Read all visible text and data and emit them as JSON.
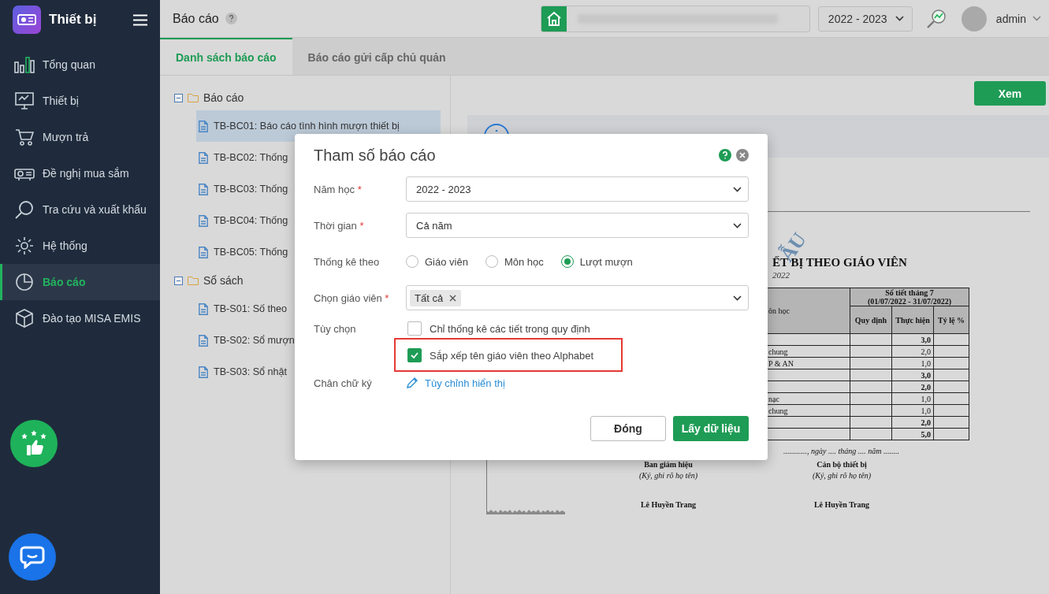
{
  "sidebar": {
    "app_title": "Thiết bị",
    "items": [
      {
        "label": "Tổng quan",
        "selected": false
      },
      {
        "label": "Thiết bị",
        "selected": false
      },
      {
        "label": "Mượn trả",
        "selected": false
      },
      {
        "label": "Đề nghị mua sắm",
        "selected": false
      },
      {
        "label": "Tra cứu và xuất khẩu",
        "selected": false
      },
      {
        "label": "Hệ thống",
        "selected": false
      },
      {
        "label": "Báo cáo",
        "selected": true
      },
      {
        "label": "Đào tạo MISA EMIS",
        "selected": false
      }
    ]
  },
  "header": {
    "title": "Báo cáo",
    "school_year": "2022 - 2023",
    "user": "admin"
  },
  "tabs": [
    {
      "label": "Danh sách báo cáo",
      "selected": true
    },
    {
      "label": "Báo cáo gửi cấp chủ quản",
      "selected": false
    }
  ],
  "tree": [
    {
      "label": "Báo cáo",
      "expanded": true,
      "children": [
        {
          "label": "TB-BC01: Báo cáo tình hình mượn thiết bị",
          "selected": true
        },
        {
          "label": "TB-BC02: Thống",
          "selected": false
        },
        {
          "label": "TB-BC03: Thống",
          "selected": false
        },
        {
          "label": "TB-BC04: Thống",
          "selected": false
        },
        {
          "label": "TB-BC05: Thống",
          "selected": false
        }
      ]
    },
    {
      "label": "Sổ sách",
      "expanded": true,
      "children": [
        {
          "label": "TB-S01: Số theo",
          "selected": false
        },
        {
          "label": "TB-S02: Sổ mượn",
          "selected": false
        },
        {
          "label": "TB-S03: Sổ nhật",
          "selected": false
        }
      ]
    }
  ],
  "preview": {
    "view_button": "Xem",
    "document": {
      "stamp": "ẪU",
      "title": "ẾT BỊ THEO GIÁO VIÊN",
      "subtitle": "2022",
      "columns": {
        "column_1": "ôn học",
        "group_title": "Số tiết tháng 7",
        "group_period": "(01/07/2022 - 31/07/2022)",
        "planned": "Quy định",
        "actual": "Thực hiện",
        "ratio": "Tỷ lệ %"
      },
      "rows": [
        {
          "column_1": "",
          "actual": "3,0",
          "total": true
        },
        {
          "column_1": "chung",
          "actual": "2,0",
          "total": false
        },
        {
          "column_1": "P & AN",
          "actual": "1,0",
          "total": false
        },
        {
          "column_1": "",
          "actual": "3,0",
          "total": true
        },
        {
          "column_1": "",
          "actual": "2,0",
          "total": true
        },
        {
          "column_1": "nạc",
          "actual": "1,0",
          "total": false
        },
        {
          "column_1": "chung",
          "actual": "1,0",
          "total": false
        },
        {
          "column_1": "",
          "actual": "2,0",
          "total": true
        },
        {
          "column_1": "",
          "actual": "5,0",
          "total": true
        }
      ],
      "date_line": "............, ngày .... tháng .... năm ........",
      "signers": [
        {
          "role": "Ban giám hiệu",
          "hint": "(Ký, ghi rõ họ tên)",
          "name": "Lê Huyền Trang"
        },
        {
          "role": "Cán bộ thiết bị",
          "hint": "(Ký, ghi rõ họ tên)",
          "name": "Lê Huyền Trang"
        }
      ]
    }
  },
  "dialog": {
    "title": "Tham số báo cáo",
    "school_year": {
      "label": "Năm học",
      "required_mark": "*",
      "value": "2022 - 2023"
    },
    "period": {
      "label": "Thời gian",
      "required_mark": "*",
      "value": "Cả năm"
    },
    "group_by": {
      "label": "Thống kê theo",
      "options": [
        {
          "label": "Giáo viên",
          "selected": false
        },
        {
          "label": "Môn học",
          "selected": false
        },
        {
          "label": "Lượt mượn",
          "selected": true
        }
      ]
    },
    "teacher": {
      "label": "Chọn giáo viên",
      "required_mark": "*",
      "tags": [
        "Tất cả"
      ]
    },
    "options": {
      "label": "Tùy chọn",
      "items": [
        {
          "label": "Chỉ thống kê các tiết trong quy định",
          "checked": false,
          "highlighted": false
        },
        {
          "label": "Sắp xếp tên giáo viên theo Alphabet",
          "checked": true,
          "highlighted": true
        }
      ]
    },
    "signature": {
      "label": "Chân chữ ký",
      "link": "Tùy chỉnh hiển thị"
    },
    "buttons": {
      "close": "Đóng",
      "submit": "Lấy dữ liệu"
    }
  }
}
